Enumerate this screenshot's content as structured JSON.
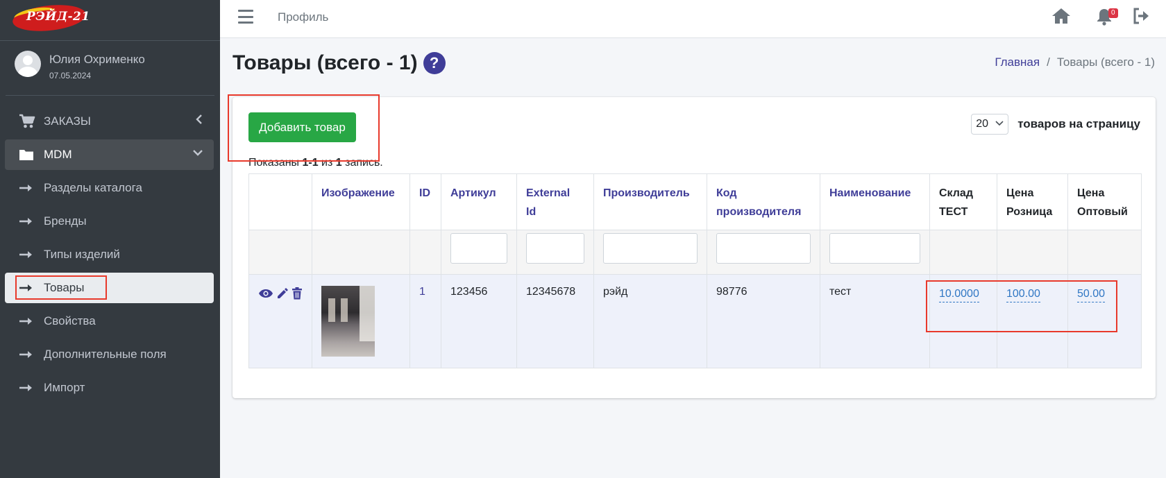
{
  "brand": {
    "logo_text": "РЭЙД-21",
    "colors": {
      "red": "#cf1d1d",
      "yellow": "#f3c615"
    }
  },
  "user": {
    "name": "Юлия Охрименко",
    "date": "07.05.2024"
  },
  "sidebar": {
    "items": [
      {
        "label": "ЗАКАЗЫ",
        "icon": "cart-icon",
        "chevron": "chevron-left-icon"
      },
      {
        "label": "MDM",
        "icon": "folder-icon",
        "chevron": "chevron-down-icon"
      }
    ],
    "subitems": [
      {
        "label": "Разделы каталога",
        "icon": "arrow-right-icon"
      },
      {
        "label": "Бренды",
        "icon": "arrow-right-icon"
      },
      {
        "label": "Типы изделий",
        "icon": "arrow-right-icon"
      },
      {
        "label": "Товары",
        "icon": "arrow-right-icon",
        "active": true
      },
      {
        "label": "Свойства",
        "icon": "arrow-right-icon"
      },
      {
        "label": "Дополнительные поля",
        "icon": "arrow-right-icon"
      },
      {
        "label": "Импорт",
        "icon": "arrow-right-icon"
      }
    ]
  },
  "topbar": {
    "link": "Профиль",
    "notifications_count": "0"
  },
  "page": {
    "title": "Товары (всего - 1)",
    "help_label": "?",
    "breadcrumb": {
      "home": "Главная",
      "separator": "/",
      "current": "Товары (всего - 1)"
    }
  },
  "toolbar": {
    "add_button": "Добавить товар",
    "per_page_value": "20",
    "per_page_label": "товаров на страницу"
  },
  "summary": {
    "prefix": "Показаны ",
    "range": "1-1",
    "middle": " из ",
    "total": "1",
    "suffix": " запись."
  },
  "table": {
    "columns": [
      {
        "line1": "",
        "line2": ""
      },
      {
        "line1": "Изображение",
        "line2": ""
      },
      {
        "line1": "ID",
        "line2": ""
      },
      {
        "line1": "Артикул",
        "line2": ""
      },
      {
        "line1": "External",
        "line2": "Id"
      },
      {
        "line1": "Производитель",
        "line2": ""
      },
      {
        "line1": "Код",
        "line2": "производителя"
      },
      {
        "line1": "Наименование",
        "line2": ""
      },
      {
        "line1": "Склад",
        "line2": "ТЕСТ"
      },
      {
        "line1": "Цена",
        "line2": "Розница"
      },
      {
        "line1": "Цена",
        "line2": "Оптовый"
      }
    ],
    "rows": [
      {
        "id": "1",
        "article": "123456",
        "external_id": "12345678",
        "manufacturer": "рэйд",
        "manufacturer_code": "98776",
        "name": "тест",
        "stock_test": "10.0000",
        "price_retail": "100.00",
        "price_wholesale": "50.00"
      }
    ]
  },
  "colors": {
    "accent": "#3f3d98",
    "success": "#28a745",
    "annotation": "#e8392b",
    "sidebar_bg": "#343a40"
  }
}
